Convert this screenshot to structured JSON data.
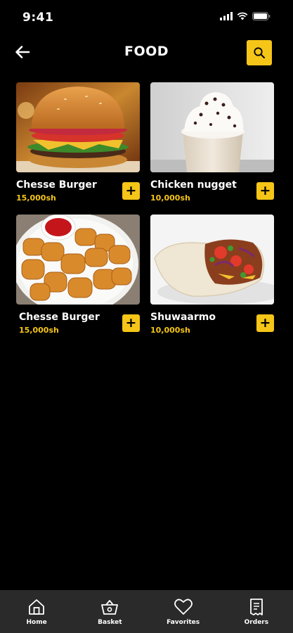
{
  "status": {
    "time": "9:41"
  },
  "header": {
    "title": "FOOD"
  },
  "items": [
    {
      "name": "Chesse Burger",
      "price": "15,000sh"
    },
    {
      "name": "Chicken nugget",
      "price": "10,000sh"
    },
    {
      "name": "Chesse Burger",
      "price": "15,000sh"
    },
    {
      "name": "Shuwaarmo",
      "price": "10,000sh"
    }
  ],
  "nav": [
    {
      "label": "Home",
      "icon": "home-icon"
    },
    {
      "label": "Basket",
      "icon": "basket-icon"
    },
    {
      "label": "Favorites",
      "icon": "heart-icon"
    },
    {
      "label": "Orders",
      "icon": "receipt-icon"
    }
  ],
  "colors": {
    "accent": "#F5C518",
    "background": "#000000",
    "nav_background": "#2A2A2A"
  }
}
